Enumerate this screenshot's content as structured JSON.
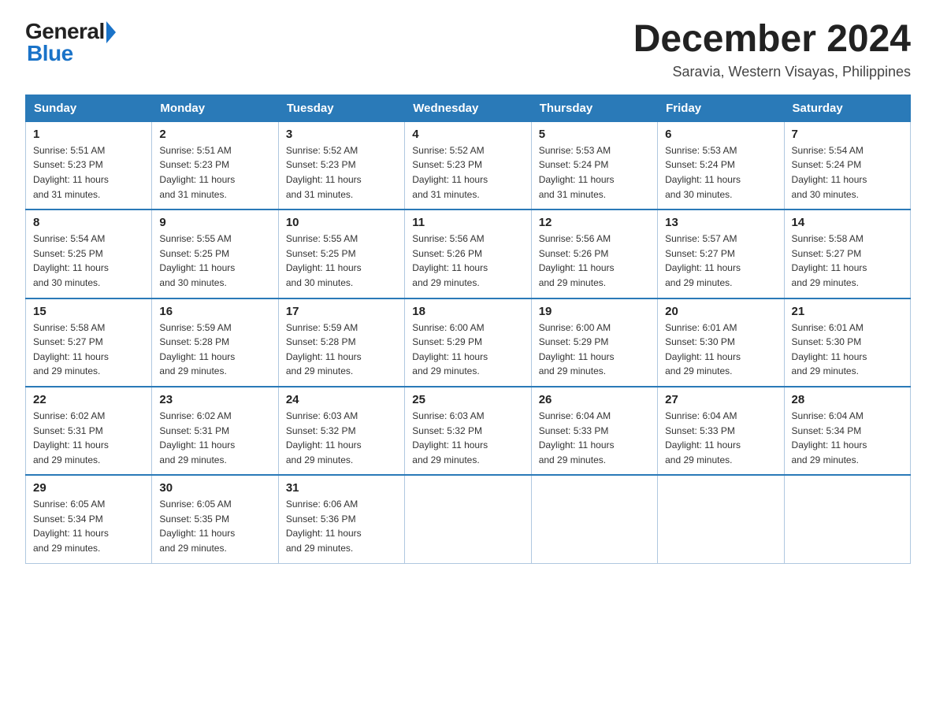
{
  "header": {
    "logo_general": "General",
    "logo_blue": "Blue",
    "month_title": "December 2024",
    "location": "Saravia, Western Visayas, Philippines"
  },
  "weekdays": [
    "Sunday",
    "Monday",
    "Tuesday",
    "Wednesday",
    "Thursday",
    "Friday",
    "Saturday"
  ],
  "weeks": [
    [
      {
        "day": "1",
        "sunrise": "5:51 AM",
        "sunset": "5:23 PM",
        "daylight": "11 hours and 31 minutes."
      },
      {
        "day": "2",
        "sunrise": "5:51 AM",
        "sunset": "5:23 PM",
        "daylight": "11 hours and 31 minutes."
      },
      {
        "day": "3",
        "sunrise": "5:52 AM",
        "sunset": "5:23 PM",
        "daylight": "11 hours and 31 minutes."
      },
      {
        "day": "4",
        "sunrise": "5:52 AM",
        "sunset": "5:23 PM",
        "daylight": "11 hours and 31 minutes."
      },
      {
        "day": "5",
        "sunrise": "5:53 AM",
        "sunset": "5:24 PM",
        "daylight": "11 hours and 31 minutes."
      },
      {
        "day": "6",
        "sunrise": "5:53 AM",
        "sunset": "5:24 PM",
        "daylight": "11 hours and 30 minutes."
      },
      {
        "day": "7",
        "sunrise": "5:54 AM",
        "sunset": "5:24 PM",
        "daylight": "11 hours and 30 minutes."
      }
    ],
    [
      {
        "day": "8",
        "sunrise": "5:54 AM",
        "sunset": "5:25 PM",
        "daylight": "11 hours and 30 minutes."
      },
      {
        "day": "9",
        "sunrise": "5:55 AM",
        "sunset": "5:25 PM",
        "daylight": "11 hours and 30 minutes."
      },
      {
        "day": "10",
        "sunrise": "5:55 AM",
        "sunset": "5:25 PM",
        "daylight": "11 hours and 30 minutes."
      },
      {
        "day": "11",
        "sunrise": "5:56 AM",
        "sunset": "5:26 PM",
        "daylight": "11 hours and 29 minutes."
      },
      {
        "day": "12",
        "sunrise": "5:56 AM",
        "sunset": "5:26 PM",
        "daylight": "11 hours and 29 minutes."
      },
      {
        "day": "13",
        "sunrise": "5:57 AM",
        "sunset": "5:27 PM",
        "daylight": "11 hours and 29 minutes."
      },
      {
        "day": "14",
        "sunrise": "5:58 AM",
        "sunset": "5:27 PM",
        "daylight": "11 hours and 29 minutes."
      }
    ],
    [
      {
        "day": "15",
        "sunrise": "5:58 AM",
        "sunset": "5:27 PM",
        "daylight": "11 hours and 29 minutes."
      },
      {
        "day": "16",
        "sunrise": "5:59 AM",
        "sunset": "5:28 PM",
        "daylight": "11 hours and 29 minutes."
      },
      {
        "day": "17",
        "sunrise": "5:59 AM",
        "sunset": "5:28 PM",
        "daylight": "11 hours and 29 minutes."
      },
      {
        "day": "18",
        "sunrise": "6:00 AM",
        "sunset": "5:29 PM",
        "daylight": "11 hours and 29 minutes."
      },
      {
        "day": "19",
        "sunrise": "6:00 AM",
        "sunset": "5:29 PM",
        "daylight": "11 hours and 29 minutes."
      },
      {
        "day": "20",
        "sunrise": "6:01 AM",
        "sunset": "5:30 PM",
        "daylight": "11 hours and 29 minutes."
      },
      {
        "day": "21",
        "sunrise": "6:01 AM",
        "sunset": "5:30 PM",
        "daylight": "11 hours and 29 minutes."
      }
    ],
    [
      {
        "day": "22",
        "sunrise": "6:02 AM",
        "sunset": "5:31 PM",
        "daylight": "11 hours and 29 minutes."
      },
      {
        "day": "23",
        "sunrise": "6:02 AM",
        "sunset": "5:31 PM",
        "daylight": "11 hours and 29 minutes."
      },
      {
        "day": "24",
        "sunrise": "6:03 AM",
        "sunset": "5:32 PM",
        "daylight": "11 hours and 29 minutes."
      },
      {
        "day": "25",
        "sunrise": "6:03 AM",
        "sunset": "5:32 PM",
        "daylight": "11 hours and 29 minutes."
      },
      {
        "day": "26",
        "sunrise": "6:04 AM",
        "sunset": "5:33 PM",
        "daylight": "11 hours and 29 minutes."
      },
      {
        "day": "27",
        "sunrise": "6:04 AM",
        "sunset": "5:33 PM",
        "daylight": "11 hours and 29 minutes."
      },
      {
        "day": "28",
        "sunrise": "6:04 AM",
        "sunset": "5:34 PM",
        "daylight": "11 hours and 29 minutes."
      }
    ],
    [
      {
        "day": "29",
        "sunrise": "6:05 AM",
        "sunset": "5:34 PM",
        "daylight": "11 hours and 29 minutes."
      },
      {
        "day": "30",
        "sunrise": "6:05 AM",
        "sunset": "5:35 PM",
        "daylight": "11 hours and 29 minutes."
      },
      {
        "day": "31",
        "sunrise": "6:06 AM",
        "sunset": "5:36 PM",
        "daylight": "11 hours and 29 minutes."
      },
      null,
      null,
      null,
      null
    ]
  ],
  "labels": {
    "sunrise_prefix": "Sunrise: ",
    "sunset_prefix": "Sunset: ",
    "daylight_prefix": "Daylight: "
  }
}
